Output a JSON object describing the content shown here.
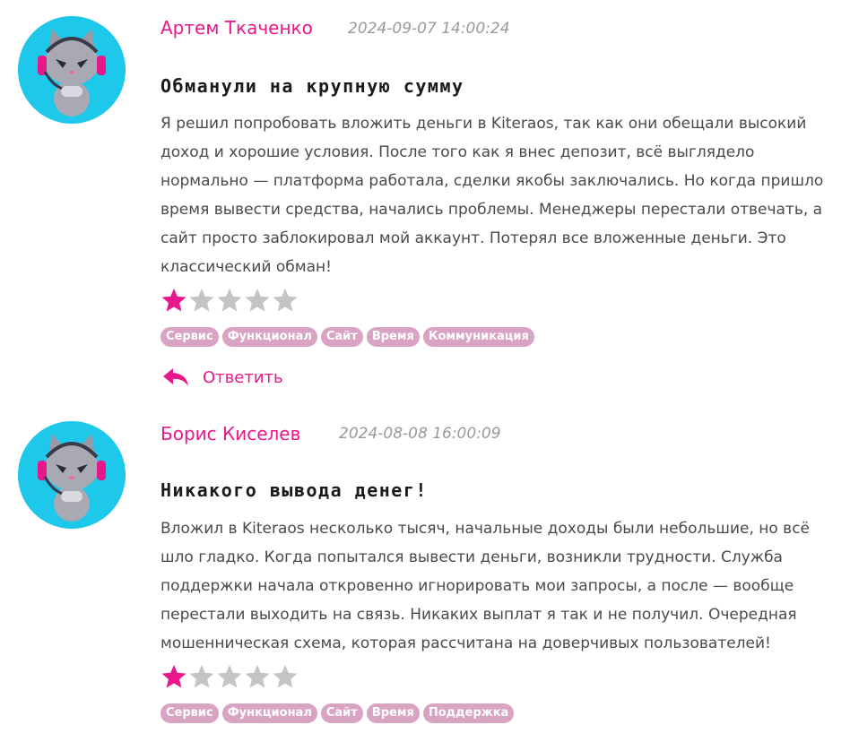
{
  "reviews": [
    {
      "author": "Артем Ткаченко",
      "date": "2024-09-07 14:00:24",
      "title": "Обманули на крупную сумму",
      "body": "Я решил попробовать вложить деньги в Kiteraos, так как они обещали высокий доход и хорошие условия. После того как я внес депозит, всё выглядело нормально — платформа работала, сделки якобы заключались. Но когда пришло время вывести средства, начались проблемы. Менеджеры перестали отвечать, а сайт просто заблокировал мой аккаунт. Потерял все вложенные деньги. Это классический обман!",
      "rating": 1,
      "max_rating": 5,
      "tags": [
        "Сервис",
        "Функционал",
        "Сайт",
        "Время",
        "Коммуникация"
      ],
      "reply_label": "Ответить"
    },
    {
      "author": "Борис Киселев",
      "date": "2024-08-08 16:00:09",
      "title": "Никакого вывода денег!",
      "body": "Вложил в Kiteraos несколько тысяч, начальные доходы были небольшие, но всё шло гладко. Когда попытался вывести деньги, возникли трудности. Служба поддержки начала откровенно игнорировать мои запросы, а после — вообще перестали выходить на связь. Никаких выплат я так и не получил. Очередная мошенническая схема, которая рассчитана на доверчивых пользователей!",
      "rating": 1,
      "max_rating": 5,
      "tags": [
        "Сервис",
        "Функционал",
        "Сайт",
        "Время",
        "Поддержка"
      ]
    }
  ],
  "colors": {
    "accent": "#e8188c",
    "avatar_bg": "#1ec8ea",
    "tag_bg": "#d9a3c3",
    "star_empty": "#c4c4c4",
    "star_filled": "#e8188c"
  },
  "icons": {
    "avatar": "cat-gamer-icon",
    "reply": "reply-arrow-icon",
    "star": "star-icon"
  }
}
